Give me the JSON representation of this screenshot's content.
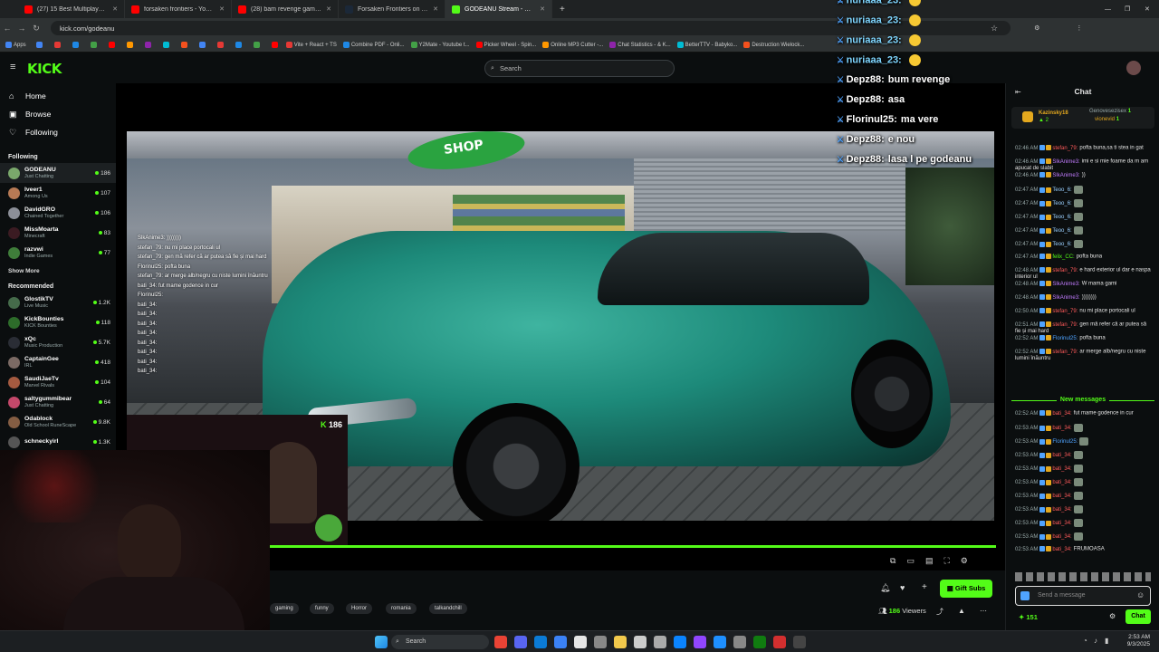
{
  "browser": {
    "tabs": [
      {
        "label": "(27) 15 Best Multiplayer Horror",
        "color": "#ff0000"
      },
      {
        "label": "forsaken frontiers - YouTube",
        "color": "#ff0000"
      },
      {
        "label": "(28) bam revenge gameplay - Y",
        "color": "#ff0000"
      },
      {
        "label": "Forsaken Frontiers on Steam",
        "color": "#1b2838"
      },
      {
        "label": "GODEANU Stream - Watch",
        "color": "#53fc18"
      }
    ],
    "url": "kick.com/godeanu",
    "bookmarks": [
      "Apps",
      "Vite + React + TS",
      "Combine PDF - Onli...",
      "Y2Mate - Youtube t...",
      "Picker Wheel - Spin...",
      "Online MP3 Cutter -...",
      "Chat Statistics - & K...",
      "BetterTTV - Babyko...",
      "Destruction Wielock..."
    ]
  },
  "kick": {
    "logo": "KICK",
    "search_placeholder": "Search"
  },
  "sidebar": {
    "nav": [
      {
        "label": "Home",
        "icon": "home-icon"
      },
      {
        "label": "Browse",
        "icon": "browse-icon"
      },
      {
        "label": "Following",
        "icon": "heart-icon"
      }
    ],
    "following_title": "Following",
    "following": [
      {
        "name": "GODEANU",
        "cat": "Just Chatting",
        "viewers": "186",
        "color": "#7aa86b"
      },
      {
        "name": "Iveer1",
        "cat": "Among Us",
        "viewers": "107",
        "color": "#b77a55"
      },
      {
        "name": "DavidGRO",
        "cat": "Chained Together",
        "viewers": "106",
        "color": "#8c8f98"
      },
      {
        "name": "MissMoarta",
        "cat": "Minecraft",
        "viewers": "83",
        "color": "#3b1b22"
      },
      {
        "name": "razvwi",
        "cat": "Indie Games",
        "viewers": "77",
        "color": "#3f7d3a"
      }
    ],
    "show_more": "Show More",
    "recommended_title": "Recommended",
    "recommended": [
      {
        "name": "GlostikTV",
        "cat": "Live Music",
        "viewers": "1.2K",
        "color": "#456b4a"
      },
      {
        "name": "KickBounties",
        "cat": "KICK Bounties",
        "viewers": "118",
        "color": "#2d6c2a"
      },
      {
        "name": "xQc",
        "cat": "Music Production",
        "viewers": "5.7K",
        "color": "#2a2d35"
      },
      {
        "name": "CaptainGee",
        "cat": "IRL",
        "viewers": "418",
        "color": "#7b6a64"
      },
      {
        "name": "SaudiJaeTv",
        "cat": "Marvel Rivals",
        "viewers": "104",
        "color": "#a45a40"
      },
      {
        "name": "saltygummibear",
        "cat": "Just Chatting",
        "viewers": "64",
        "color": "#c4486a"
      },
      {
        "name": "Odablock",
        "cat": "Old School RuneScape",
        "viewers": "9.8K",
        "color": "#845d43"
      },
      {
        "name": "schneckyirl",
        "cat": "",
        "viewers": "1.3K",
        "color": "#555"
      }
    ]
  },
  "overlay_chat": [
    {
      "user": "nuriaaa_23:",
      "text": "",
      "color": "#7fd6ff"
    },
    {
      "user": "nuriaaa_23:",
      "text": "",
      "color": "#7fd6ff"
    },
    {
      "user": "nuriaaa_23:",
      "text": "",
      "color": "#7fd6ff"
    },
    {
      "user": "nuriaaa_23:",
      "text": "",
      "color": "#7fd6ff"
    },
    {
      "user": "Depz88:",
      "text": "bum revenge",
      "color": "#ffffff"
    },
    {
      "user": "Depz88:",
      "text": "asa",
      "color": "#ffffff"
    },
    {
      "user": "Florinul25:",
      "text": "ma vere",
      "color": "#ffffff"
    },
    {
      "user": "Depz88:",
      "text": "e nou",
      "color": "#ffffff"
    },
    {
      "user": "Depz88:",
      "text": "lasa l pe godeanu",
      "color": "#ffffff"
    }
  ],
  "video_chat": [
    "SlkAnime3: ))))))))",
    "stefan_79: nu mi place portocali ul",
    "stefan_79: gen mă refer că ar putea să fie și mai hard",
    "Florinul25: pofta buna",
    "stefan_79: ar merge alb/negru cu niste lumini înăuntru",
    "bati_34: fut mame godence in cur",
    "Florinul25:",
    "bati_34:",
    "bati_34:",
    "bati_34:",
    "bati_34:",
    "bati_34:",
    "bati_34:",
    "bati_34:",
    "bati_34:"
  ],
  "cam_viewers": "186",
  "stream": {
    "tags": [
      "gaming",
      "funny",
      "Horror",
      "romania",
      "talkandchill"
    ],
    "gift_subs": "Gift Subs",
    "viewers": "186",
    "viewers_label": "Viewers"
  },
  "chat": {
    "title": "Chat",
    "pinned": [
      {
        "name": "Kazinsky18",
        "count": "2"
      },
      {
        "name": "Genovesezisex",
        "count": "1"
      },
      {
        "name": "vionevid",
        "count": "1"
      }
    ],
    "messages": [
      {
        "time": "02:46 AM",
        "user": "stefan_79:",
        "text": "pofta buna,sa ti stea in gat",
        "color": "#ff5a5a"
      },
      {
        "time": "02:46 AM",
        "user": "SlkAnime3:",
        "text": "imi e si mie foame da m am apucat de slabit",
        "color": "#c27cff"
      },
      {
        "time": "02:46 AM",
        "user": "SlkAnime3:",
        "text": "))",
        "color": "#c27cff"
      },
      {
        "time": "02:47 AM",
        "user": "Teoo_6:",
        "text": "",
        "color": "#9ad0ff"
      },
      {
        "time": "02:47 AM",
        "user": "Teoo_6:",
        "text": "",
        "color": "#9ad0ff"
      },
      {
        "time": "02:47 AM",
        "user": "Teoo_6:",
        "text": "",
        "color": "#9ad0ff"
      },
      {
        "time": "02:47 AM",
        "user": "Teoo_6:",
        "text": "",
        "color": "#9ad0ff"
      },
      {
        "time": "02:47 AM",
        "user": "Teoo_6:",
        "text": "",
        "color": "#9ad0ff"
      },
      {
        "time": "02:47 AM",
        "user": "felix_CC:",
        "text": "pofta buna",
        "color": "#53fc18"
      },
      {
        "time": "02:48 AM",
        "user": "stefan_79:",
        "text": "e hard exterior ul dar e naspa interior ul",
        "color": "#ff5a5a"
      },
      {
        "time": "02:48 AM",
        "user": "SlkAnime3:",
        "text": "W mama gami",
        "color": "#c27cff"
      },
      {
        "time": "02:48 AM",
        "user": "SlkAnime3:",
        "text": "))))))))",
        "color": "#c27cff"
      },
      {
        "time": "02:50 AM",
        "user": "stefan_79:",
        "text": "nu mi place portocali ul",
        "color": "#ff5a5a"
      },
      {
        "time": "02:51 AM",
        "user": "stefan_79:",
        "text": "gen mă refer că ar putea să fie și mai hard",
        "color": "#ff5a5a"
      },
      {
        "time": "02:52 AM",
        "user": "Florinul25:",
        "text": "pofta buna",
        "color": "#4fa3ff"
      },
      {
        "time": "02:52 AM",
        "user": "stefan_79:",
        "text": "ar merge alb/negru cu niste lumini înăuntru",
        "color": "#ff5a5a"
      }
    ],
    "new_messages": "New messages",
    "new": [
      {
        "time": "02:52 AM",
        "user": "bati_34:",
        "text": "fut mame godence in cur",
        "color": "#ff5a5a"
      },
      {
        "time": "02:53 AM",
        "user": "bati_34:",
        "text": "",
        "color": "#ff5a5a"
      },
      {
        "time": "02:53 AM",
        "user": "Florinul25:",
        "text": "",
        "color": "#4fa3ff"
      },
      {
        "time": "02:53 AM",
        "user": "bati_34:",
        "text": "",
        "color": "#ff5a5a"
      },
      {
        "time": "02:53 AM",
        "user": "bati_34:",
        "text": "",
        "color": "#ff5a5a"
      },
      {
        "time": "02:53 AM",
        "user": "bati_34:",
        "text": "",
        "color": "#ff5a5a"
      },
      {
        "time": "02:53 AM",
        "user": "bati_34:",
        "text": "",
        "color": "#ff5a5a"
      },
      {
        "time": "02:53 AM",
        "user": "bati_34:",
        "text": "",
        "color": "#ff5a5a"
      },
      {
        "time": "02:53 AM",
        "user": "bati_34:",
        "text": "",
        "color": "#ff5a5a"
      },
      {
        "time": "02:53 AM",
        "user": "bati_34:",
        "text": "",
        "color": "#ff5a5a"
      },
      {
        "time": "02:53 AM",
        "user": "bati_34:",
        "text": "FRUMOASA",
        "color": "#ff5a5a"
      }
    ],
    "input_placeholder": "Send a message",
    "points": "151",
    "send_label": "Chat"
  },
  "taskbar": {
    "search": "Search",
    "time": "2:53 AM",
    "date": "9/3/2025"
  }
}
